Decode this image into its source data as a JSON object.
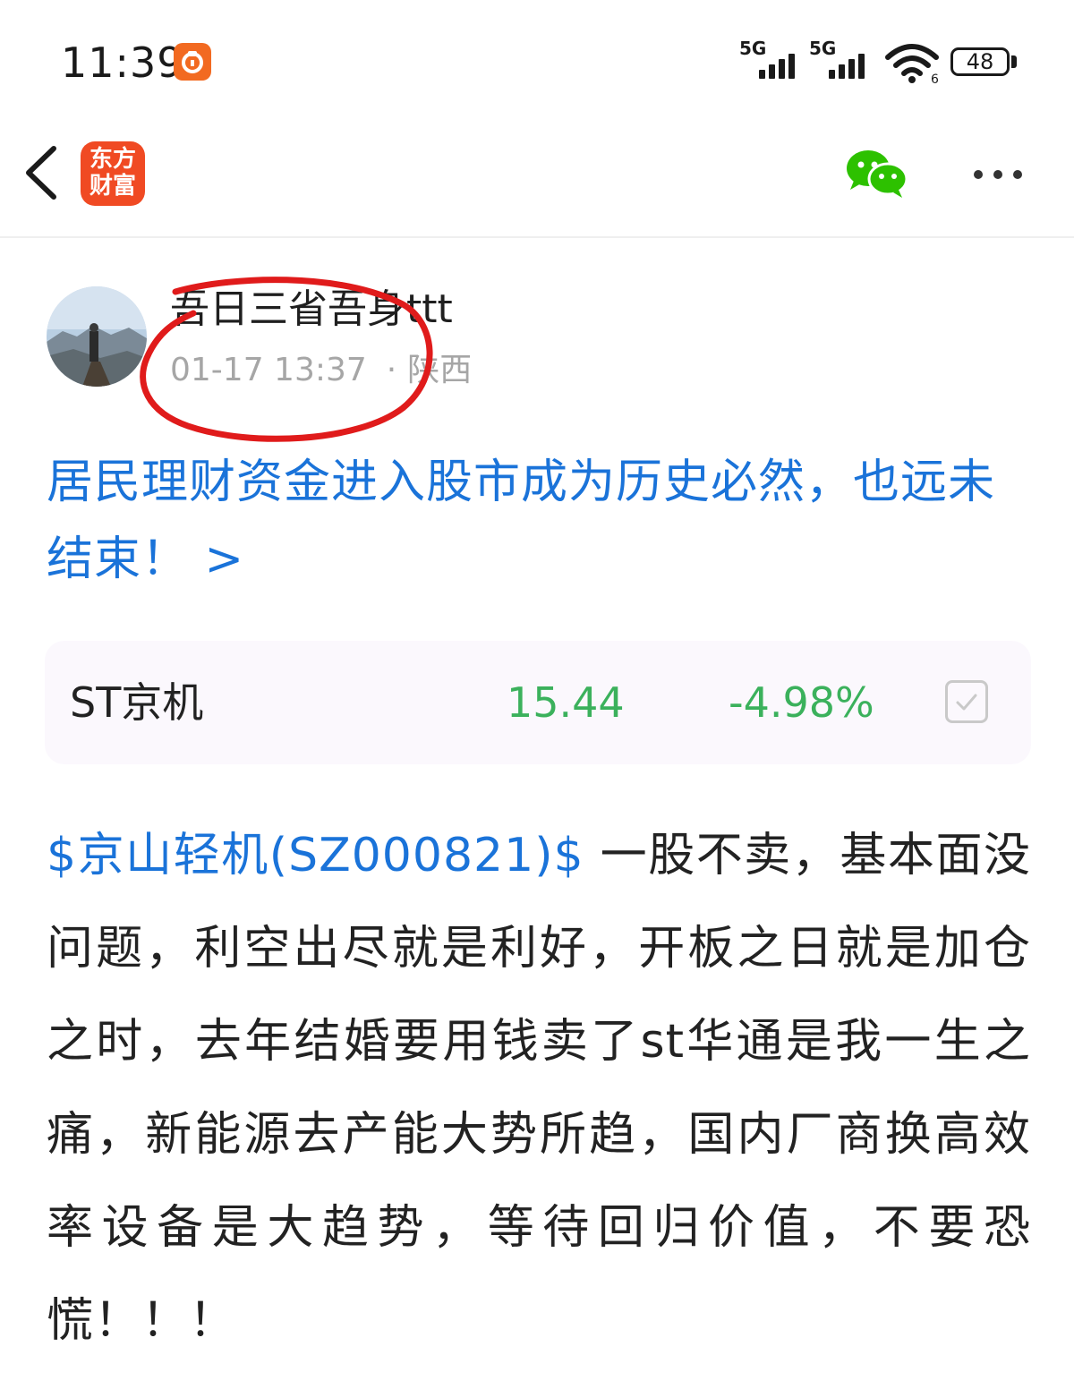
{
  "status_bar": {
    "time": "11:39",
    "signal_1_label": "5G",
    "signal_2_label": "5G",
    "battery_level": "48",
    "wifi_badge": "6",
    "notification_icon": "orange-app-icon"
  },
  "header": {
    "app_logo_line1": "东方",
    "app_logo_line2": "财富",
    "back_icon": "chevron-left-icon",
    "share_icon": "wechat-icon",
    "more_icon": "more-dots-icon"
  },
  "post": {
    "author": "吾日三省吾身ttt",
    "date": "01-17 13:37",
    "separator": "·",
    "location": "陕西",
    "title": "居民理财资金进入股市成为历史必然，也远未结束！ >",
    "stock_card": {
      "name": "ST京机",
      "price": "15.44",
      "change": "-4.98%",
      "down_color": "#3bb15c"
    },
    "body_link": "$京山轻机(SZ000821)$",
    "body_text": " 一股不卖，基本面没问题，利空出尽就是利好，开板之日就是加仓之时，去年结婚要用钱卖了st华通是我一生之痛，新能源去产能大势所趋，国内厂商换高效率设备是大趋势，等待回归价值，不要恐慌！！！"
  },
  "colors": {
    "link_blue": "#1a73d9",
    "annotation_red": "#e01b1b",
    "brand_orange": "#f04a23"
  }
}
